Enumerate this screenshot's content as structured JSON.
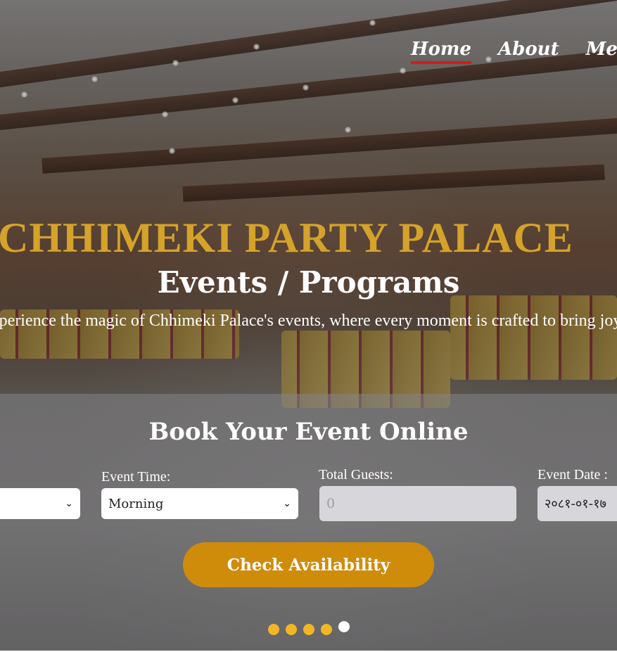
{
  "nav": {
    "items": [
      {
        "label": "Home",
        "active": true
      },
      {
        "label": "About",
        "active": false
      },
      {
        "label": "Menu",
        "active": false
      }
    ]
  },
  "hero": {
    "title": "CHHIMEKI PARTY PALACE",
    "subtitle": "Events / Programs",
    "tagline": "Experience the magic of Chhimeki Palace's events, where every moment is crafted to bring joy."
  },
  "booking": {
    "heading": "Book Your Event Online",
    "event_type": {
      "value": ""
    },
    "event_time": {
      "label": "Event Time:",
      "value": "Morning"
    },
    "total_guests": {
      "label": "Total Guests:",
      "placeholder": "0"
    },
    "event_date": {
      "label": "Event Date :",
      "value": "२०८१-०१-१७"
    },
    "button_label": "Check Availability"
  },
  "slider": {
    "count": 5,
    "active_index": 4
  },
  "colors": {
    "title_gold": "#d5a22a",
    "button_orange": "#cf8c0b",
    "dot_yellow": "#f2b624",
    "nav_underline": "#d71a1a"
  }
}
